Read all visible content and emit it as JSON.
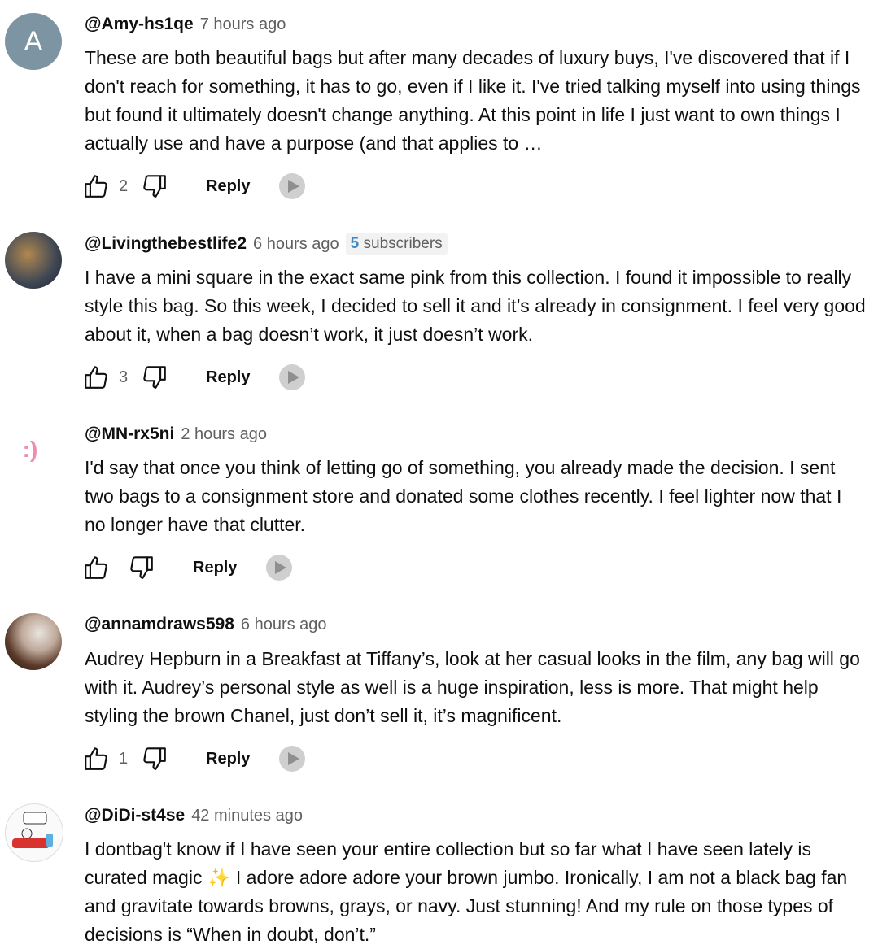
{
  "comments": [
    {
      "avatar_letter": "A",
      "author": "@Amy-hs1qe",
      "time": "7 hours ago",
      "text": "These are both beautiful bags but after many decades of luxury buys, I've discovered that if I don't reach for something, it has to go, even if I like it.  I've tried talking myself into using things but found it ultimately doesn't change anything.  At this point in life I just want to own things I actually use and have a purpose (and that applies to …",
      "likes": "2",
      "reply_label": "Reply"
    },
    {
      "author": "@Livingthebestlife2",
      "time": "6 hours ago",
      "subs_count": "5",
      "subs_label": "subscribers",
      "text": "I have a mini square in the exact same pink from this collection. I found it impossible to really style this bag. So this week, I decided to sell it and it’s already in consignment. I feel very good about it, when a bag doesn’t work, it just doesn’t work.",
      "likes": "3",
      "reply_label": "Reply"
    },
    {
      "avatar_text": ":)",
      "author": "@MN-rx5ni",
      "time": "2 hours ago",
      "text": "I'd say that once you think of letting go of something, you already made the decision. I sent two bags to a consignment store and donated some clothes recently. I feel lighter now that I no longer have that clutter.",
      "likes": "",
      "reply_label": "Reply"
    },
    {
      "author": "@annamdraws598",
      "time": "6 hours ago",
      "text": "Audrey Hepburn in a Breakfast at Tiffany’s, look at her casual looks in the film, any bag will go with it. Audrey’s personal style as well is a huge inspiration, less is more. That might help styling the brown Chanel, just don’t sell it, it’s magnificent.",
      "likes": "1",
      "reply_label": "Reply"
    },
    {
      "author": "@DiDi-st4se",
      "time": "42 minutes ago",
      "text": "I dontbag't know if I have seen your entire collection but so far what I have seen lately is curated magic ✨ I adore adore adore your brown jumbo. Ironically, I am not a black bag fan and gravitate towards browns, grays, or navy. Just stunning! And my rule on those types of decisions is “When in doubt, don’t.”"
    }
  ],
  "icons": {
    "like": "thumbs-up-icon",
    "dislike": "thumbs-down-icon",
    "badge": "member-badge-icon"
  },
  "colors": {
    "secondary_text": "#606060",
    "subscriber_count": "#3e88c5",
    "avatar_letter_bg": "#7d95a3",
    "smiley": "#f08cb2"
  }
}
